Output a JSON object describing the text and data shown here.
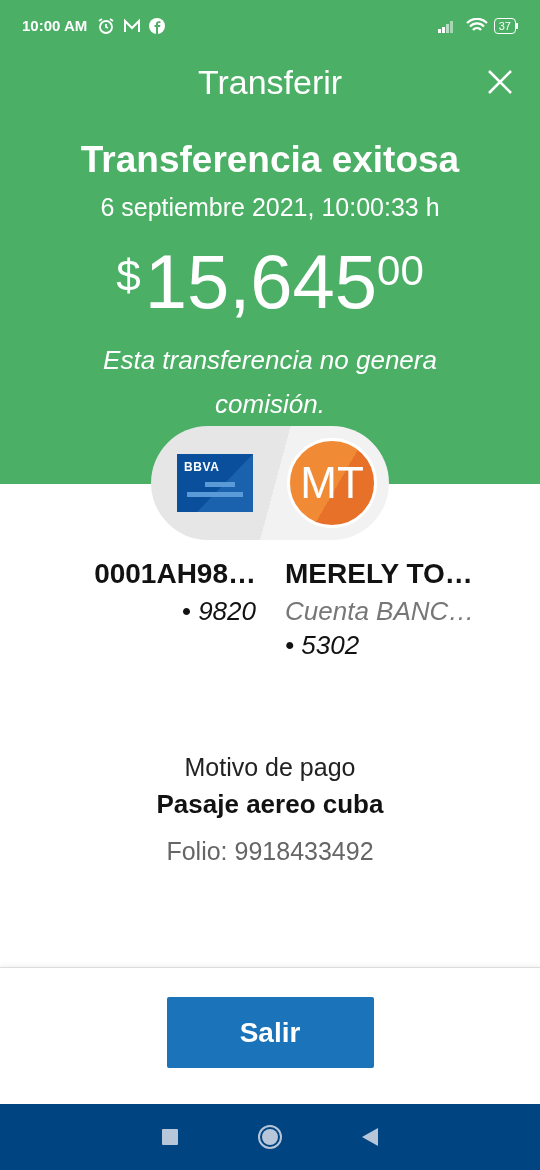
{
  "status_bar": {
    "time": "10:00 AM",
    "battery": "37"
  },
  "header": {
    "title": "Transferir"
  },
  "result": {
    "title": "Transferencia exitosa",
    "date": "6 septiembre 2021, 10:00:33 h",
    "amount": {
      "symbol": "$",
      "integer": "15,645",
      "cents": "00"
    },
    "note": "Esta transferencia no genera comisión."
  },
  "origin": {
    "card_label": "BBVA",
    "name": "0001AH98…",
    "digits": "• 9820"
  },
  "destination": {
    "initials": "MT",
    "name": "MERELY TO…",
    "account": "Cuenta BANC…",
    "digits": "• 5302"
  },
  "details": {
    "label": "Motivo de pago",
    "value": "Pasaje aereo cuba",
    "folio": "Folio: 9918433492"
  },
  "button": "Salir"
}
